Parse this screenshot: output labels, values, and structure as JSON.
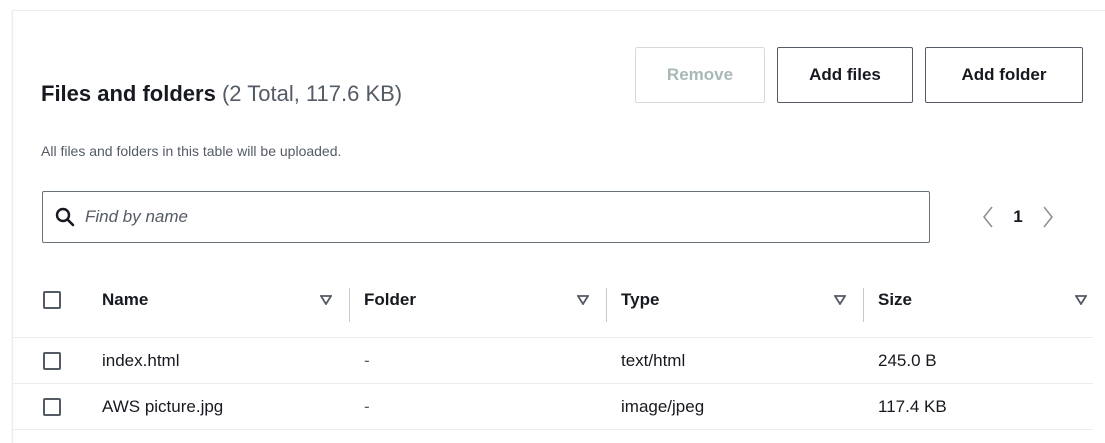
{
  "header": {
    "title": "Files and folders",
    "counter": "(2 Total, 117.6 KB)",
    "description": "All files and folders in this table will be uploaded."
  },
  "actions": {
    "remove_label": "Remove",
    "add_files_label": "Add files",
    "add_folder_label": "Add folder"
  },
  "search": {
    "placeholder": "Find by name",
    "icon": "search-icon"
  },
  "pagination": {
    "current_page": "1",
    "prev_icon": "chevron-left-icon",
    "next_icon": "chevron-right-icon"
  },
  "table": {
    "columns": [
      "Name",
      "Folder",
      "Type",
      "Size"
    ],
    "rows": [
      {
        "name": "index.html",
        "folder": "-",
        "type": "text/html",
        "size": "245.0 B"
      },
      {
        "name": "AWS picture.jpg",
        "folder": "-",
        "type": "image/jpeg",
        "size": "117.4 KB"
      }
    ]
  },
  "colors": {
    "text": "#16191f",
    "secondary_text": "#545b64",
    "disabled": "#aab7b8",
    "border": "#eaeded"
  }
}
